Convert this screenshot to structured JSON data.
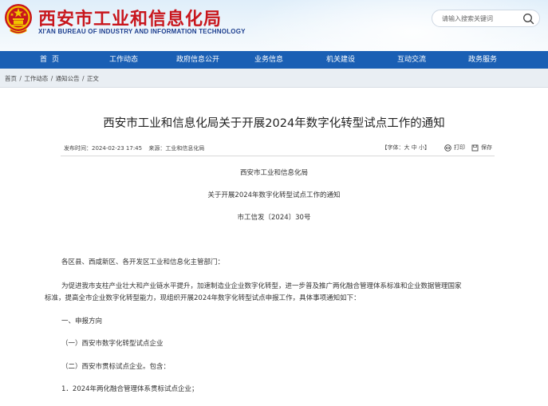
{
  "header": {
    "title_cn": "西安市工业和信息化局",
    "title_en": "XI'AN BUREAU OF INDUSTRY AND INFORMATION TECHNOLOGY",
    "search_placeholder": "请输入搜索关键词",
    "brand_red": "#c8161d",
    "brand_blue": "#1a5fb4"
  },
  "nav": {
    "items": [
      {
        "label": "首页"
      },
      {
        "label": "工作动态"
      },
      {
        "label": "政府信息公开"
      },
      {
        "label": "业务信息"
      },
      {
        "label": "机关建设"
      },
      {
        "label": "互动交流"
      },
      {
        "label": "政务服务"
      }
    ]
  },
  "breadcrumb": {
    "items": [
      "首页",
      "工作动态",
      "通知公告",
      "正文"
    ],
    "separator": "/"
  },
  "article": {
    "title": "西安市工业和信息化局关于开展2024年数字化转型试点工作的通知",
    "publish_label": "发布时间：",
    "publish_time": "2024-02-23 17:45",
    "source_label": "来源：",
    "source": "工业和信息化局",
    "font_size_control": "【字体：大 中 小】",
    "print_label": "打印",
    "save_label": "保存",
    "issuer": "西安市工业和信息化局",
    "doc_title": "关于开展2024年数字化转型试点工作的通知",
    "doc_number": "市工信发〔2024〕30号",
    "salutation": "各区县、西咸新区、各开发区工业和信息化主管部门：",
    "para1_line1": "为促进我市支柱产业壮大和产业链水平提升，加速制造业企业数字化转型，进一步普及推广两化融合管理体系标准和企业数据管理国家",
    "para1_line2": "标准，提高全市企业数字化转型能力，现组织开展2024年数字化转型试点申报工作，具体事项通知如下：",
    "section1": "一、申报方向",
    "item1": "（一）西安市数字化转型试点企业",
    "item2": "（二）西安市贯标试点企业。包含：",
    "item3": "1．2024年两化融合管理体系贯标试点企业；"
  }
}
